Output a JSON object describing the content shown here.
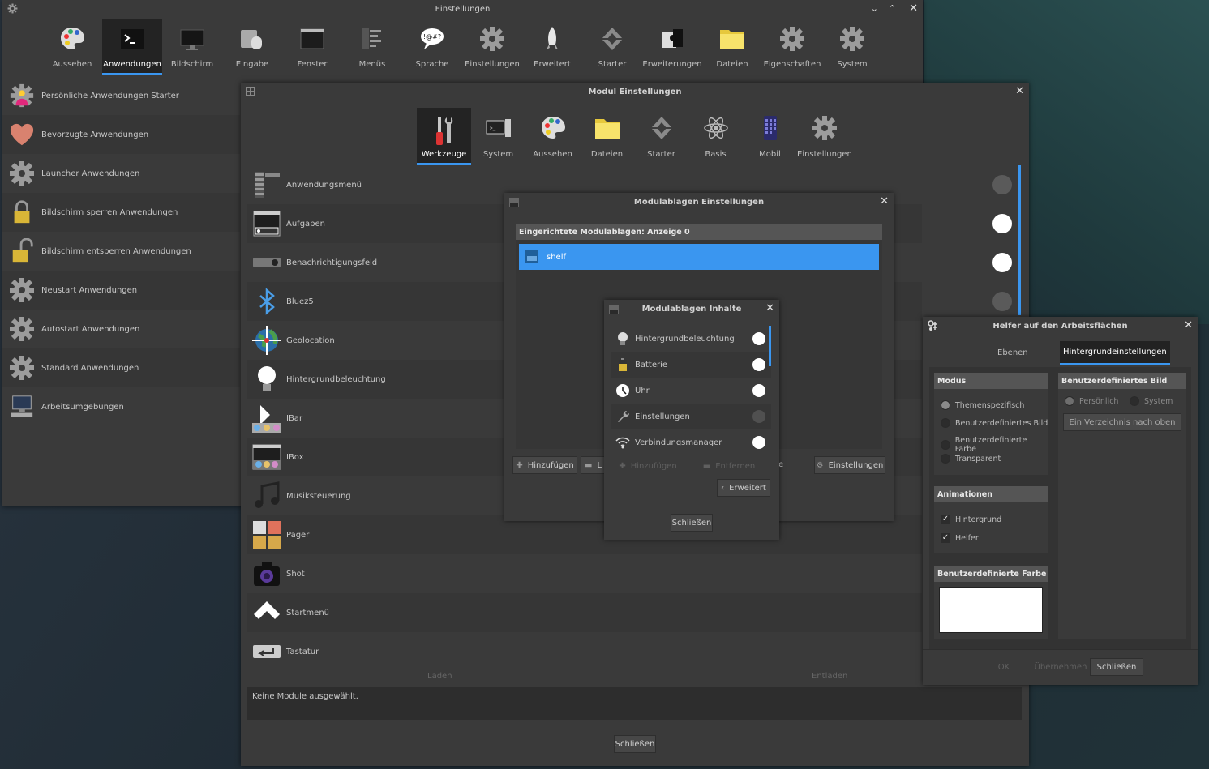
{
  "main_window": {
    "title": "Einstellungen",
    "toolbar": [
      {
        "label": "Aussehen",
        "icon": "palette-icon"
      },
      {
        "label": "Anwendungen",
        "icon": "terminal-icon",
        "selected": true
      },
      {
        "label": "Bildschirm",
        "icon": "monitor-icon"
      },
      {
        "label": "Eingabe",
        "icon": "keyboard-mouse-icon"
      },
      {
        "label": "Fenster",
        "icon": "window-icon"
      },
      {
        "label": "Menüs",
        "icon": "menu-icon"
      },
      {
        "label": "Sprache",
        "icon": "speech-bubble-icon"
      },
      {
        "label": "Einstellungen",
        "icon": "gear-icon"
      },
      {
        "label": "Erweitert",
        "icon": "rocket-icon"
      },
      {
        "label": "Starter",
        "icon": "starter-icon"
      },
      {
        "label": "Erweiterungen",
        "icon": "puzzle-icon"
      },
      {
        "label": "Dateien",
        "icon": "folder-icon"
      },
      {
        "label": "Eigenschaften",
        "icon": "gear-icon"
      },
      {
        "label": "System",
        "icon": "gear-icon"
      }
    ],
    "list": [
      {
        "label": "Persönliche Anwendungen Starter",
        "icon": "user-gear-icon"
      },
      {
        "label": "Bevorzugte Anwendungen",
        "icon": "heart-icon"
      },
      {
        "label": "Launcher Anwendungen",
        "icon": "gear-icon"
      },
      {
        "label": "Bildschirm sperren Anwendungen",
        "icon": "lock-icon"
      },
      {
        "label": "Bildschirm entsperren Anwendungen",
        "icon": "unlock-icon"
      },
      {
        "label": "Neustart Anwendungen",
        "icon": "gear-icon"
      },
      {
        "label": "Autostart Anwendungen",
        "icon": "gear-icon"
      },
      {
        "label": "Standard Anwendungen",
        "icon": "gear-icon"
      },
      {
        "label": "Arbeitsumgebungen",
        "icon": "computer-icon"
      }
    ]
  },
  "modul_window": {
    "title": "Modul Einstellungen",
    "toolbar": [
      {
        "label": "Werkzeuge",
        "icon": "tools-icon",
        "selected": true
      },
      {
        "label": "System",
        "icon": "system-icon"
      },
      {
        "label": "Aussehen",
        "icon": "palette-icon"
      },
      {
        "label": "Dateien",
        "icon": "folder-icon"
      },
      {
        "label": "Starter",
        "icon": "starter-icon"
      },
      {
        "label": "Basis",
        "icon": "atom-icon"
      },
      {
        "label": "Mobil",
        "icon": "phone-icon"
      },
      {
        "label": "Einstellungen",
        "icon": "gear-icon"
      }
    ],
    "modules": [
      {
        "label": "Anwendungsmenü",
        "toggle": "off"
      },
      {
        "label": "Aufgaben",
        "toggle": "on"
      },
      {
        "label": "Benachrichtigungsfeld",
        "toggle": "on"
      },
      {
        "label": "Bluez5",
        "toggle": "off"
      },
      {
        "label": "Geolocation"
      },
      {
        "label": "Hintergrundbeleuchtung"
      },
      {
        "label": "IBar"
      },
      {
        "label": "IBox"
      },
      {
        "label": "Musiksteuerung"
      },
      {
        "label": "Pager"
      },
      {
        "label": "Shot"
      },
      {
        "label": "Startmenü"
      },
      {
        "label": "Tastatur"
      }
    ],
    "load_label": "Laden",
    "unload_label": "Entladen",
    "description": "Keine Module ausgewählt.",
    "close_label": "Schließen"
  },
  "shelf_window": {
    "title": "Modulablagen Einstellungen",
    "header": "Eingerichtete Modulablagen: Anzeige 0",
    "items": [
      {
        "label": "shelf"
      }
    ],
    "add_label": "Hinzufügen",
    "remove_label": "L",
    "partial_label": "e",
    "settings_label": "Einstellungen"
  },
  "contents_window": {
    "title": "Modulablagen Inhalte",
    "items": [
      {
        "label": "Hintergrundbeleuchtung",
        "toggle": "on"
      },
      {
        "label": "Batterie",
        "toggle": "on"
      },
      {
        "label": "Uhr",
        "toggle": "on"
      },
      {
        "label": "Einstellungen",
        "toggle": "off"
      },
      {
        "label": "Verbindungsmanager",
        "toggle": "on"
      }
    ],
    "add_label": "Hinzufügen",
    "remove_label": "Entfernen",
    "advanced_label": "Erweitert",
    "close_label": "Schließen"
  },
  "helper_window": {
    "title": "Helfer auf den Arbeitsflächen",
    "tabs": [
      "Ebenen",
      "Hintergrundeinstellungen"
    ],
    "active_tab": "Hintergrundeinstellungen",
    "modus": {
      "title": "Modus",
      "options": [
        {
          "label": "Themenspezifisch",
          "checked": true
        },
        {
          "label": "Benutzerdefiniertes Bild",
          "checked": false
        },
        {
          "label": "Benutzerdefinierte Farbe",
          "checked": false
        },
        {
          "label": "Transparent",
          "checked": false
        }
      ]
    },
    "animations": {
      "title": "Animationen",
      "options": [
        {
          "label": "Hintergrund",
          "checked": true
        },
        {
          "label": "Helfer",
          "checked": true
        }
      ]
    },
    "custom_color": {
      "title": "Benutzerdefinierte Farbe",
      "value": "#ffffff"
    },
    "custom_image": {
      "title": "Benutzerdefiniertes Bild",
      "options": [
        {
          "label": "Persönlich"
        },
        {
          "label": "System"
        }
      ],
      "up_button": "Ein Verzeichnis nach oben"
    },
    "ok_label": "OK",
    "apply_label": "Übernehmen",
    "close_label": "Schließen"
  },
  "colors": {
    "accent": "#3a96f0",
    "selected_row": "#3a96f0"
  }
}
